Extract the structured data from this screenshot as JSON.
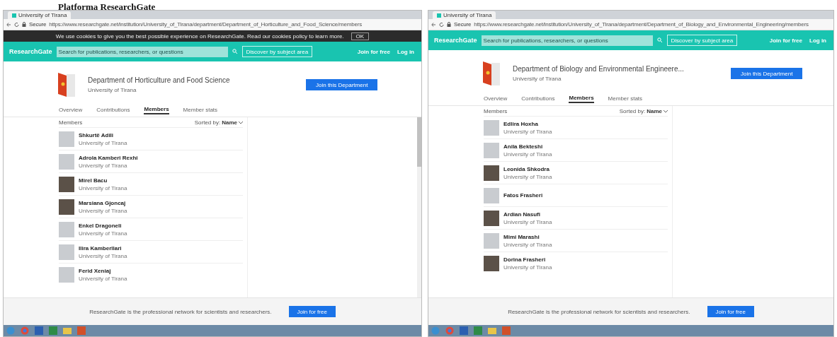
{
  "caption": "Platforma ResearchGate",
  "windows": [
    {
      "browser_tab": "University of Tirana",
      "address_secure": "Secure",
      "address": "https://www.researchgate.net/institution/University_of_Tirana/department/Department_of_Horticulture_and_Food_Science/members",
      "cookie_banner": {
        "text": "We use cookies to give you the best possible experience on ResearchGate. Read our cookies policy to learn more.",
        "button": "OK"
      },
      "header": {
        "logo": "ResearchGate",
        "search_placeholder": "Search for publications, researchers, or questions",
        "discover_button": "Discover by subject area",
        "join": "Join for free",
        "login": "Log in"
      },
      "department": {
        "name": "Department of Horticulture and Food Science",
        "institution": "University of Tirana",
        "join_button": "Join this Department"
      },
      "tabs": [
        {
          "label": "Overview",
          "selected": false
        },
        {
          "label": "Contributions",
          "selected": false
        },
        {
          "label": "Members",
          "selected": true
        },
        {
          "label": "Member stats",
          "selected": false
        }
      ],
      "members_heading": "Members",
      "sort_label": "Sorted by:",
      "sort_value": "Name",
      "members": [
        {
          "name": "Shkurtë Adili",
          "institution": "University of Tirana",
          "photo": false
        },
        {
          "name": "Adrola Kamberi Rexhi",
          "institution": "University of Tirana",
          "photo": false
        },
        {
          "name": "Mirel Bacu",
          "institution": "University of Tirana",
          "photo": true
        },
        {
          "name": "Marsiana Gjoncaj",
          "institution": "University of Tirana",
          "photo": true
        },
        {
          "name": "Enkel Dragoneli",
          "institution": "University of Tirana",
          "photo": false
        },
        {
          "name": "Ilira Kamberllari",
          "institution": "University of Tirana",
          "photo": false
        },
        {
          "name": "Ferid Xeniaj",
          "institution": "University of Tirana",
          "photo": false
        }
      ],
      "footer": {
        "text": "ResearchGate is the professional network for scientists and researchers.",
        "button": "Join for free"
      }
    },
    {
      "browser_tab": "University of Tirana",
      "address_secure": "Secure",
      "address": "https://www.researchgate.net/institution/University_of_Tirana/department/Department_of_Biology_and_Environmental_Engineering/members",
      "header": {
        "logo": "ResearchGate",
        "search_placeholder": "Search for publications, researchers, or questions",
        "discover_button": "Discover by subject area",
        "join": "Join for free",
        "login": "Log in"
      },
      "department": {
        "name": "Department of Biology and Environmental Engineere...",
        "institution": "University of Tirana",
        "join_button": "Join this Department"
      },
      "tabs": [
        {
          "label": "Overview",
          "selected": false
        },
        {
          "label": "Contributions",
          "selected": false
        },
        {
          "label": "Members",
          "selected": true
        },
        {
          "label": "Member stats",
          "selected": false
        }
      ],
      "members_heading": "Members",
      "sort_label": "Sorted by:",
      "sort_value": "Name",
      "members": [
        {
          "name": "Edlira Hoxha",
          "institution": "University of Tirana",
          "photo": false
        },
        {
          "name": "Anila Bekteshi",
          "institution": "University of Tirana",
          "photo": false
        },
        {
          "name": "Leonida Shkodra",
          "institution": "University of Tirana",
          "photo": true
        },
        {
          "name": "Fatos Frasheri",
          "photo": false
        },
        {
          "name": "Ardian Nasufi",
          "institution": "University of Tirana",
          "photo": true
        },
        {
          "name": "Mimi Marashi",
          "institution": "University of Tirana",
          "photo": false
        },
        {
          "name": "Dorina Frasheri",
          "institution": "University of Tirana",
          "photo": true
        }
      ],
      "footer": {
        "text": "ResearchGate is the professional network for scientists and researchers.",
        "button": "Join for free"
      }
    }
  ]
}
